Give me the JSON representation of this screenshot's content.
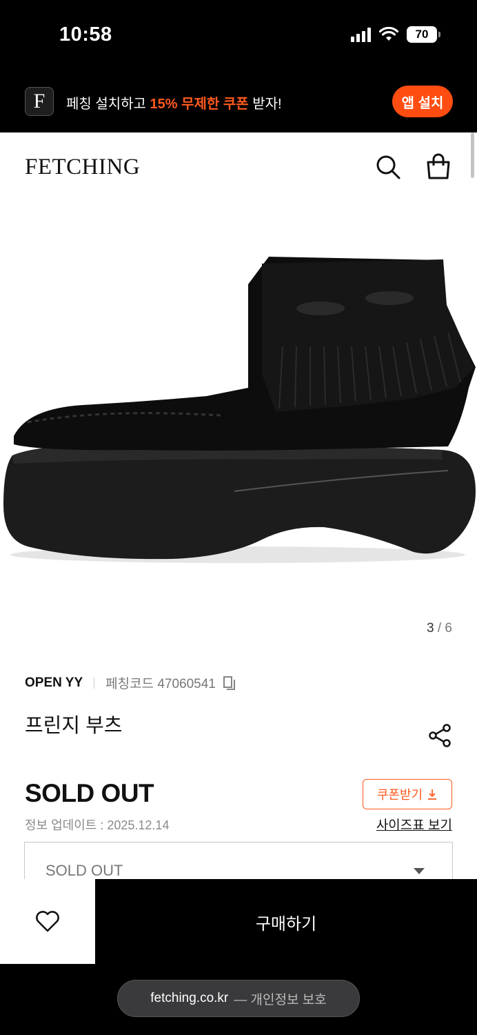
{
  "status_bar": {
    "time": "10:58",
    "battery": "70"
  },
  "banner": {
    "logo_letter": "F",
    "message_prefix": "페칭 설치하고 ",
    "message_highlight": "15% 무제한 쿠폰",
    "message_suffix": " 받자!",
    "install_label": "앱 설치",
    "accent_color": "#ff4d12"
  },
  "header": {
    "brand": "FETCHING",
    "search_icon": "search-icon",
    "cart_icon": "shopping-bag-icon"
  },
  "product": {
    "image_description_icon": "product-image",
    "image_index": "3",
    "image_total": "6",
    "brand": "OPEN YY",
    "code_label": "페칭코드 47060541",
    "title": "프린지 부츠",
    "price": "SOLD OUT",
    "updated": "정보 업데이트 : 2025.12.14",
    "coupon_label": "쿠폰받기",
    "size_chart_label": "사이즈표 보기",
    "option_value": "SOLD OUT"
  },
  "bottom_bar": {
    "buy_label": "구매하기"
  },
  "url_bar": {
    "domain": "fetching.co.kr",
    "suffix": "— 개인정보 보호"
  }
}
